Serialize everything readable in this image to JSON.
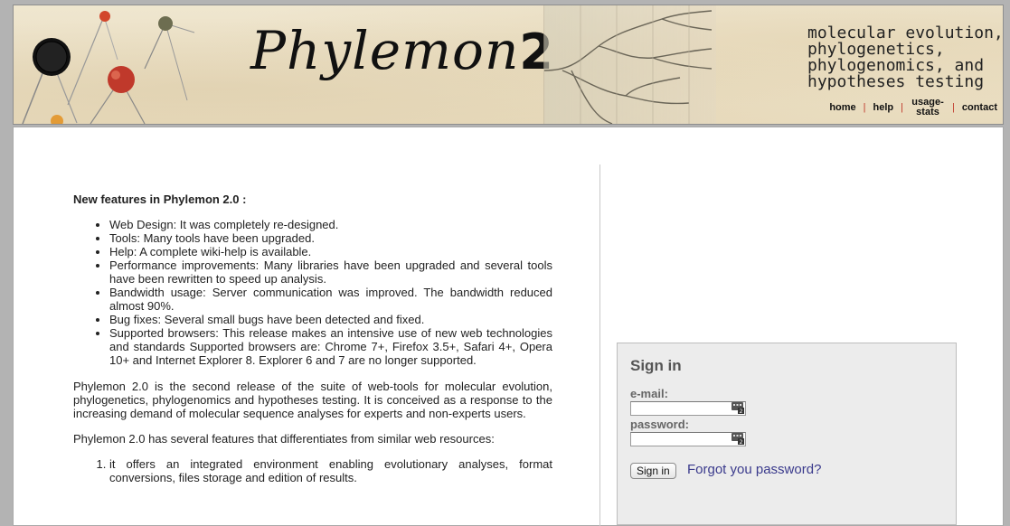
{
  "header": {
    "logo_text": "Phylemon",
    "logo_number": "2",
    "tagline_lines": [
      "molecular evolution,",
      "phylogenetics,",
      "phylogenomics, and",
      "hypotheses testing"
    ],
    "nav": {
      "home": "home",
      "help": "help",
      "usage_stats": "usage-stats",
      "contact": "contact"
    }
  },
  "article": {
    "features_heading": "New features in Phylemon 2.0 :",
    "features": [
      "Web Design: It was completely re-designed.",
      "Tools: Many tools have been upgraded.",
      "Help: A complete wiki-help is available.",
      "Performance improvements: Many libraries have been upgraded and several tools have been rewritten to speed up analysis.",
      "Bandwidth usage: Server communication was improved. The bandwidth reduced almost 90%.",
      "Bug fixes: Several small bugs have been detected and fixed.",
      "Supported browsers: This release makes an intensive use of new web technologies and standards Supported browsers are: Chrome 7+, Firefox 3.5+, Safari 4+, Opera 10+ and Internet Explorer 8. Explorer 6 and 7 are no longer supported."
    ],
    "paragraph_1": "Phylemon 2.0 is the second release of the suite of web-tools for molecular evolution, phylogenetics, phylogenomics and hypotheses testing. It is conceived as a response to the increasing demand of molecular sequence analyses for experts and non-experts users.",
    "paragraph_2": "Phylemon 2.0 has several features that differentiates from similar web resources:",
    "ordered_items": [
      "it offers an integrated environment enabling evolutionary analyses, format conversions, files storage and edition of results."
    ]
  },
  "signin": {
    "title": "Sign in",
    "email_label": "e-mail:",
    "email_value": "",
    "password_label": "password:",
    "password_value": "",
    "button_label": "Sign in",
    "forgot_label": "Forgot you password?",
    "field_icon": "password-manager-key-icon"
  },
  "colors": {
    "page_background": "#b3b3b3",
    "banner_background": "#ece1c8",
    "nav_separator": "#c0392b",
    "link": "#3a3a8c",
    "signin_panel": "#ececec"
  }
}
